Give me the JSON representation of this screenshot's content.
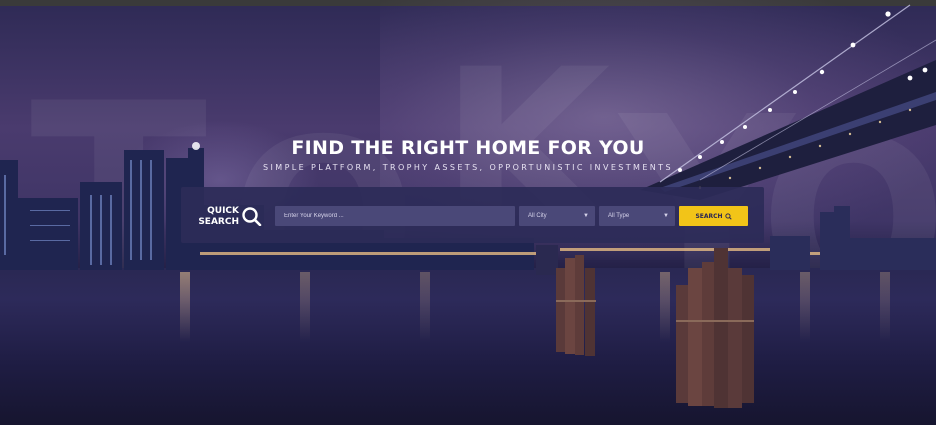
{
  "hero": {
    "headline": "FIND THE RIGHT HOME FOR YOU",
    "subline": "SIMPLE PLATFORM, TROPHY ASSETS, OPPORTUNISTIC INVESTMENTS",
    "watermark": [
      "T",
      "O",
      "K",
      "Y",
      "O"
    ]
  },
  "quick_search": {
    "label_line1": "QUICK",
    "label_line2": "SEARCH",
    "icon": "search-icon",
    "keyword_placeholder": "Enter Your Keyword ...",
    "city_value": "All City",
    "type_value": "All Type",
    "button_label": "SEARCH",
    "button_icon": "search-icon"
  },
  "colors": {
    "bar_bg": "#2d2b58",
    "field_bg": "#4a4878",
    "button_bg": "#f2c418",
    "button_text": "#2a2653",
    "headline": "#ffffff"
  }
}
